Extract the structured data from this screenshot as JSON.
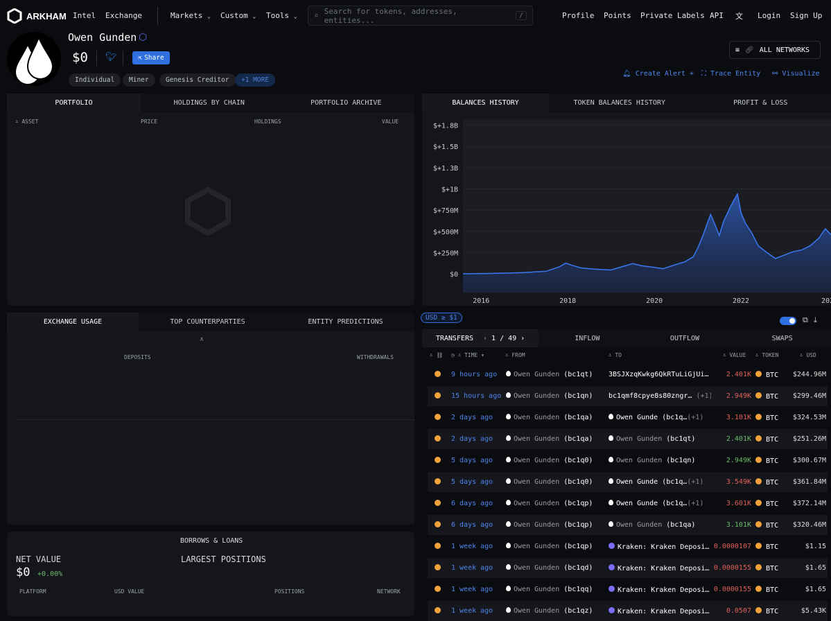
{
  "nav": {
    "brand": "ARKHAM",
    "links": [
      "Intel",
      "Exchange"
    ],
    "menus": [
      "Markets",
      "Custom",
      "Tools"
    ],
    "search_placeholder": "Search for tokens, addresses, entities...",
    "search_key": "/",
    "right": [
      "Profile",
      "Points",
      "Private Labels",
      "API",
      "Login",
      "Sign Up"
    ]
  },
  "entity": {
    "name": "Owen Gunden",
    "balance": "$0",
    "share": "Share",
    "tags": [
      "Individual",
      "Miner",
      "Genesis Creditor"
    ],
    "more": "+1 MORE"
  },
  "actions": {
    "networks": "ALL NETWORKS",
    "create_alert": "Create Alert +",
    "trace": "Trace Entity",
    "visualize": "Visualize"
  },
  "portfolio": {
    "tabs": [
      "PORTFOLIO",
      "HOLDINGS BY CHAIN",
      "PORTFOLIO ARCHIVE"
    ],
    "cols": [
      "ASSET",
      "PRICE",
      "HOLDINGS",
      "VALUE"
    ]
  },
  "balances": {
    "tabs": [
      "BALANCES HISTORY",
      "TOKEN BALANCES HISTORY",
      "PROFIT & LOSS"
    ]
  },
  "chart_data": {
    "type": "area",
    "title": "Balances History",
    "ytick_labels": [
      "$0",
      "$+250M",
      "$+500M",
      "$+750M",
      "$+1B",
      "$+1.3B",
      "$+1.5B",
      "$+1.8B"
    ],
    "yticks": [
      0,
      250,
      500,
      750,
      1000,
      1250,
      1500,
      1750
    ],
    "xtick_labels": [
      "2016",
      "2018",
      "2020",
      "2022",
      "202"
    ],
    "xticks": [
      2016,
      2018,
      2020,
      2022,
      2024
    ],
    "xlim": [
      2015.58,
      2024.08
    ],
    "ylim": [
      -220,
      1820
    ],
    "unit": "USD millions",
    "x": [
      2015.58,
      2016,
      2016.5,
      2017,
      2017.5,
      2017.8,
      2017.95,
      2018.1,
      2018.3,
      2018.6,
      2019,
      2019.3,
      2019.5,
      2019.7,
      2020,
      2020.2,
      2020.5,
      2020.7,
      2020.9,
      2021.0,
      2021.1,
      2021.2,
      2021.3,
      2021.4,
      2021.5,
      2021.6,
      2021.75,
      2021.85,
      2021.92,
      2022.0,
      2022.1,
      2022.25,
      2022.4,
      2022.6,
      2022.8,
      2023.0,
      2023.2,
      2023.4,
      2023.6,
      2023.8,
      2023.95,
      2024.08
    ],
    "y": [
      0,
      3,
      8,
      15,
      30,
      80,
      125,
      100,
      70,
      55,
      45,
      90,
      120,
      95,
      75,
      60,
      110,
      140,
      200,
      300,
      420,
      560,
      700,
      580,
      450,
      620,
      780,
      880,
      940,
      720,
      600,
      480,
      330,
      250,
      180,
      220,
      260,
      280,
      330,
      420,
      530,
      460
    ]
  },
  "filter": {
    "usd": "USD ≥ $1"
  },
  "transfers": {
    "tabs": [
      "TRANSFERS",
      "INFLOW",
      "OUTFLOW",
      "SWAPS"
    ],
    "page": "1",
    "pages": "49",
    "cols": [
      "TIME",
      "FROM",
      "TO",
      "VALUE",
      "TOKEN",
      "USD"
    ],
    "rows": [
      {
        "time": "9 hours ago",
        "from": "Owen Gunden",
        "from_addr": "(bc1qt)",
        "to": "3BSJXzqKwkg6QkRTuLiGjUi…",
        "to_addr": "",
        "extra": "",
        "value": "2.401K",
        "dir": "out",
        "token": "BTC",
        "usd": "$244.96M",
        "to_entity": false
      },
      {
        "time": "15 hours ago",
        "from": "Owen Gunden",
        "from_addr": "(bc1qn)",
        "to": "bc1qmf8cpye8s80zngr…",
        "to_addr": "",
        "extra": "(+1)",
        "value": "2.949K",
        "dir": "out",
        "token": "BTC",
        "usd": "$299.46M",
        "to_entity": false
      },
      {
        "time": "2 days ago",
        "from": "Owen Gunden",
        "from_addr": "(bc1qa)",
        "to": "Owen Gunde",
        "to_addr": "(bc1q…",
        "extra": "(+1)",
        "value": "3.101K",
        "dir": "out",
        "token": "BTC",
        "usd": "$324.53M",
        "to_entity": true
      },
      {
        "time": "2 days ago",
        "from": "Owen Gunden",
        "from_addr": "(bc1qa)",
        "to": "Owen Gunden",
        "to_addr": "(bc1qt)",
        "extra": "",
        "value": "2.401K",
        "dir": "in",
        "token": "BTC",
        "usd": "$251.26M",
        "to_entity": true
      },
      {
        "time": "5 days ago",
        "from": "Owen Gunden",
        "from_addr": "(bc1q0)",
        "to": "Owen Gunden",
        "to_addr": "(bc1qn)",
        "extra": "",
        "value": "2.949K",
        "dir": "in",
        "token": "BTC",
        "usd": "$300.67M",
        "to_entity": true
      },
      {
        "time": "5 days ago",
        "from": "Owen Gunden",
        "from_addr": "(bc1q0)",
        "to": "Owen Gunde",
        "to_addr": "(bc1q…",
        "extra": "(+1)",
        "value": "3.549K",
        "dir": "out",
        "token": "BTC",
        "usd": "$361.84M",
        "to_entity": true
      },
      {
        "time": "6 days ago",
        "from": "Owen Gunden",
        "from_addr": "(bc1qp)",
        "to": "Owen Gunde",
        "to_addr": "(bc1q…",
        "extra": "(+1)",
        "value": "3.601K",
        "dir": "out",
        "token": "BTC",
        "usd": "$372.14M",
        "to_entity": true
      },
      {
        "time": "6 days ago",
        "from": "Owen Gunden",
        "from_addr": "(bc1qp)",
        "to": "Owen Gunden",
        "to_addr": "(bc1qa)",
        "extra": "",
        "value": "3.101K",
        "dir": "in",
        "token": "BTC",
        "usd": "$320.46M",
        "to_entity": true
      },
      {
        "time": "1 week ago",
        "from": "Owen Gunden",
        "from_addr": "(bc1qp)",
        "to": "Kraken: Kraken Deposi…",
        "to_addr": "",
        "extra": "",
        "value": "0.0000107",
        "dir": "out",
        "token": "BTC",
        "usd": "$1.15",
        "to_entity": "kraken"
      },
      {
        "time": "1 week ago",
        "from": "Owen Gunden",
        "from_addr": "(bc1qd)",
        "to": "Kraken: Kraken Deposi…",
        "to_addr": "",
        "extra": "",
        "value": "0.0000155",
        "dir": "out",
        "token": "BTC",
        "usd": "$1.65",
        "to_entity": "kraken"
      },
      {
        "time": "1 week ago",
        "from": "Owen Gunden",
        "from_addr": "(bc1qq)",
        "to": "Kraken: Kraken Deposi…",
        "to_addr": "",
        "extra": "",
        "value": "0.0000155",
        "dir": "out",
        "token": "BTC",
        "usd": "$1.65",
        "to_entity": "kraken"
      },
      {
        "time": "1 week ago",
        "from": "Owen Gunden",
        "from_addr": "(bc1qz)",
        "to": "Kraken: Kraken Deposi…",
        "to_addr": "",
        "extra": "",
        "value": "0.0507",
        "dir": "out",
        "token": "BTC",
        "usd": "$5.43K",
        "to_entity": "kraken"
      }
    ]
  },
  "exchange": {
    "tabs": [
      "EXCHANGE USAGE",
      "TOP COUNTERPARTIES",
      "ENTITY PREDICTIONS"
    ],
    "deposits": "DEPOSITS",
    "withdrawals": "WITHDRAWALS"
  },
  "borrows": {
    "title": "BORROWS & LOANS",
    "net_label": "NET VALUE",
    "net": "$0",
    "change": "+0.00%",
    "largest": "LARGEST POSITIONS",
    "cols": [
      "PLATFORM",
      "USD VALUE",
      "POSITIONS",
      "NETWORK"
    ]
  },
  "colors": {
    "accent": "#2f6fe0",
    "out": "#e0605a",
    "in": "#6dbb6a",
    "btc": "#f2a23a"
  }
}
